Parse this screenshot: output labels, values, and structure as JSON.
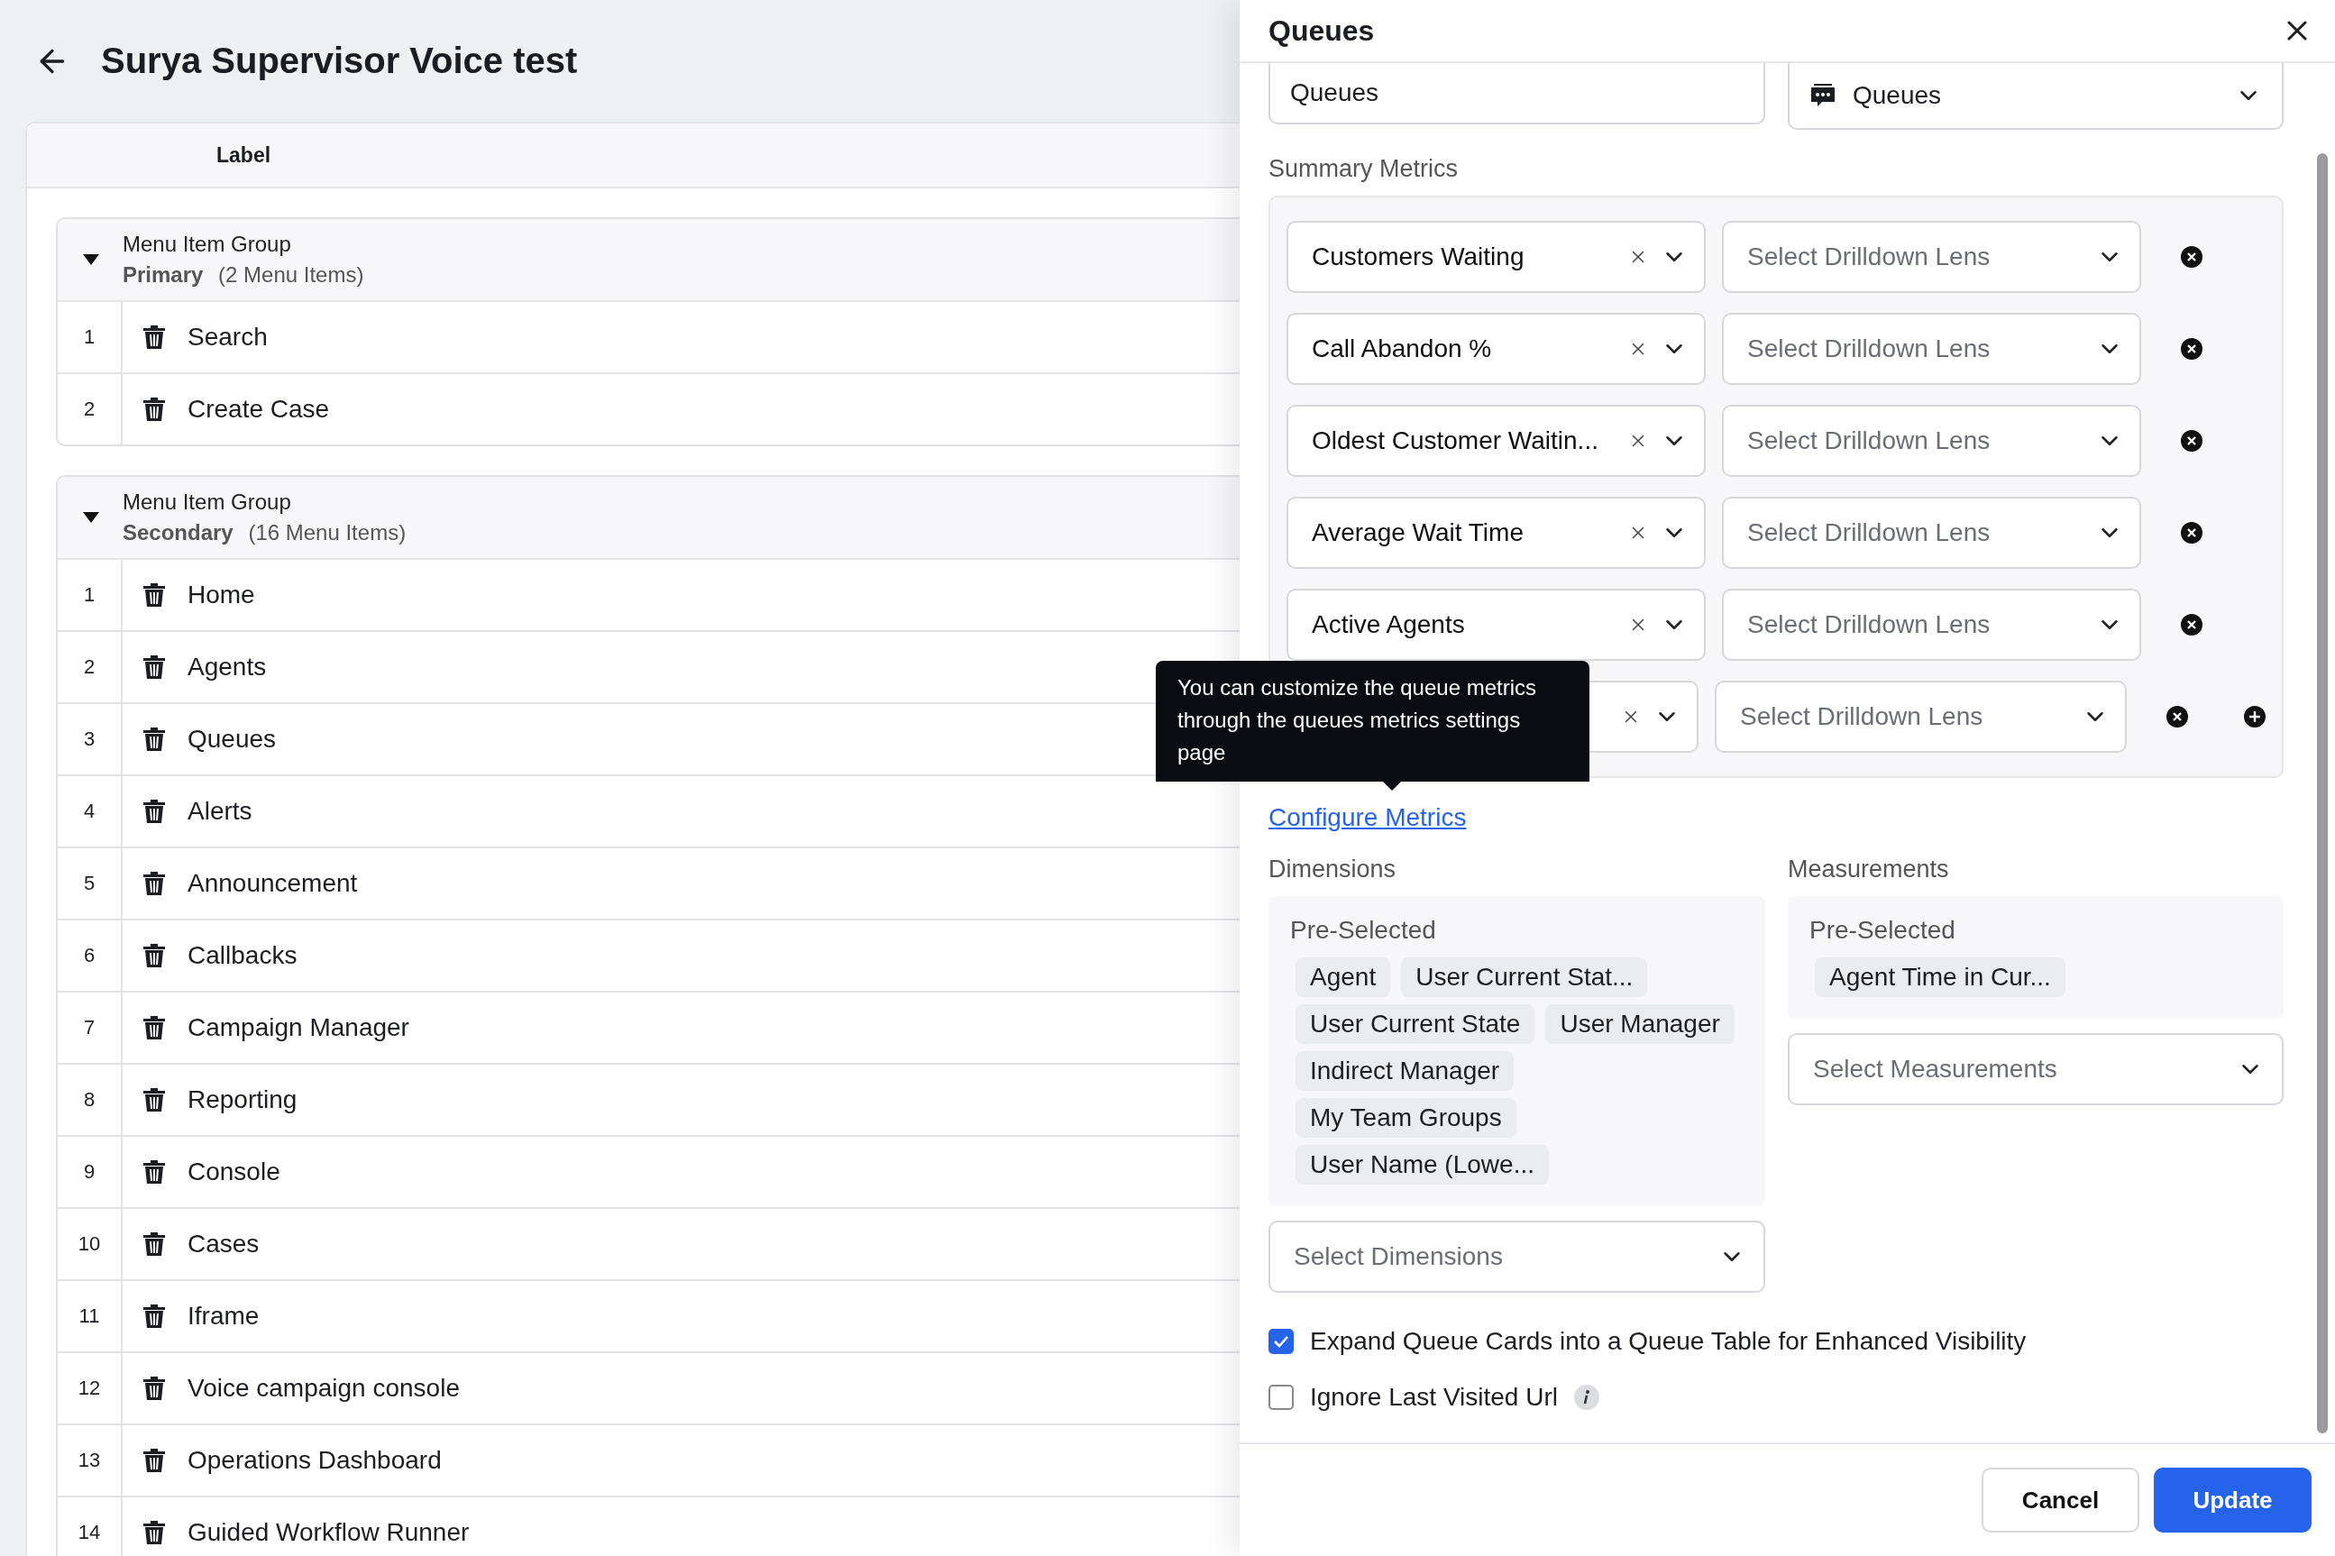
{
  "page": {
    "title": "Surya Supervisor Voice test"
  },
  "table": {
    "columns": [
      "Label"
    ],
    "groups": [
      {
        "kind_label": "Menu Item Group",
        "name": "Primary",
        "count": "(2 Menu Items)",
        "expanded": true,
        "items": [
          {
            "index": "1",
            "label": "Search"
          },
          {
            "index": "2",
            "label": "Create Case"
          }
        ]
      },
      {
        "kind_label": "Menu Item Group",
        "name": "Secondary",
        "count": "(16 Menu Items)",
        "expanded": true,
        "items": [
          {
            "index": "1",
            "label": "Home"
          },
          {
            "index": "2",
            "label": "Agents"
          },
          {
            "index": "3",
            "label": "Queues"
          },
          {
            "index": "4",
            "label": "Alerts"
          },
          {
            "index": "5",
            "label": "Announcement"
          },
          {
            "index": "6",
            "label": "Callbacks"
          },
          {
            "index": "7",
            "label": "Campaign Manager"
          },
          {
            "index": "8",
            "label": "Reporting"
          },
          {
            "index": "9",
            "label": "Console"
          },
          {
            "index": "10",
            "label": "Cases"
          },
          {
            "index": "11",
            "label": "Iframe"
          },
          {
            "index": "12",
            "label": "Voice campaign console"
          },
          {
            "index": "13",
            "label": "Operations Dashboard"
          },
          {
            "index": "14",
            "label": "Guided Workflow Runner"
          }
        ]
      }
    ]
  },
  "drawer": {
    "title": "Queues",
    "label_value": "Queues",
    "icon_value": "Queues",
    "summary_metrics": {
      "title": "Summary Metrics",
      "rows": [
        {
          "metric": "Customers Waiting",
          "lens_placeholder": "Select Drilldown Lens"
        },
        {
          "metric": "Call Abandon %",
          "lens_placeholder": "Select Drilldown Lens"
        },
        {
          "metric": "Oldest Customer Waitin...",
          "lens_placeholder": "Select Drilldown Lens"
        },
        {
          "metric": "Average Wait Time",
          "lens_placeholder": "Select Drilldown Lens"
        },
        {
          "metric": "Active Agents",
          "lens_placeholder": "Select Drilldown Lens"
        },
        {
          "lens_placeholder": "Select Drilldown Lens"
        }
      ]
    },
    "tooltip": "You can customize the queue metrics through the queues metrics settings page",
    "configure_link": "Configure Metrics",
    "dimensions": {
      "title": "Dimensions",
      "preselected_title": "Pre-Selected",
      "chips": [
        "Agent",
        "User Current Stat...",
        "User Current State",
        "User Manager",
        "Indirect Manager",
        "My Team Groups",
        "User Name (Lowe..."
      ],
      "placeholder": "Select Dimensions"
    },
    "measurements": {
      "title": "Measurements",
      "preselected_title": "Pre-Selected",
      "chips": [
        "Agent Time in Cur..."
      ],
      "placeholder": "Select Measurements"
    },
    "options": [
      {
        "label": "Expand Queue Cards into a Queue Table for Enhanced Visibility",
        "checked": true,
        "info": false
      },
      {
        "label": "Ignore Last Visited Url",
        "checked": false,
        "info": true
      }
    ],
    "buttons": [
      {
        "label": "Cancel",
        "kind": "secondary"
      },
      {
        "label": "Update",
        "kind": "primary"
      }
    ]
  }
}
